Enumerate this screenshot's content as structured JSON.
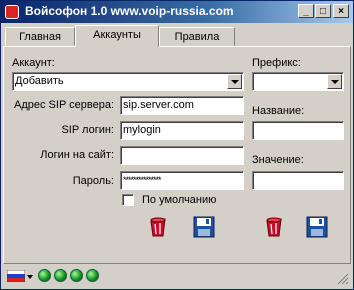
{
  "window": {
    "title": "Войсофон 1.0 www.voip-russia.com"
  },
  "tabs": [
    "Главная",
    "Аккаунты",
    "Правила"
  ],
  "active_tab": "Аккаунты",
  "account": {
    "label": "Аккаунт:",
    "selected": "Добавить",
    "server_label": "Адрес SIP сервера:",
    "server_value": "sip.server.com",
    "login_label": "SIP логин:",
    "login_value": "mylogin",
    "site_login_label": "Логин на сайт:",
    "site_login_value": "",
    "password_label": "Пароль:",
    "password_value": "***************",
    "default_label": "По умолчанию"
  },
  "rules": {
    "prefix_label": "Префикс:",
    "prefix_value": "",
    "name_label": "Название:",
    "name_value": "",
    "value_label": "Значение:",
    "value_value": ""
  },
  "status": {
    "flag": "russian-flag-icon",
    "indicator_count": 4
  },
  "colors": {
    "title_start": "#0a246a",
    "title_end": "#a6caf0",
    "indicator": "#1a8a1a",
    "trash": "#c8102e",
    "floppy": "#1f4fa0"
  }
}
